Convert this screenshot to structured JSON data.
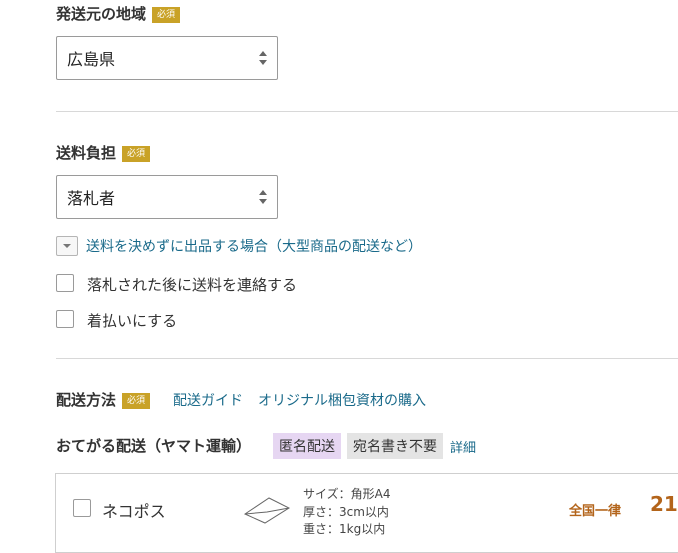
{
  "origin": {
    "label": "発送元の地域",
    "badge": "必須",
    "value": "広島県"
  },
  "shipping_cost": {
    "label": "送料負担",
    "badge": "必須",
    "value": "落札者",
    "expand_link": "送料を決めずに出品する場合（大型商品の配送など）",
    "options": [
      {
        "label": "落札された後に送料を連絡する",
        "checked": false
      },
      {
        "label": "着払いにする",
        "checked": false
      }
    ]
  },
  "delivery": {
    "label": "配送方法",
    "badge": "必須",
    "guide_link": "配送ガイド",
    "packaging_link": "オリジナル梱包資材の購入",
    "service_title": "おてがる配送（ヤマト運輸）",
    "tag_anonymous": "匿名配送",
    "tag_no_address": "宛名書き不要",
    "details_link": "詳細",
    "option": {
      "name": "ネコポス",
      "spec_size": "サイズ：角形A4",
      "spec_thickness": "厚さ：3cm以内",
      "spec_weight": "重さ：1kg以内",
      "price_label": "全国一律",
      "price": "21"
    }
  }
}
